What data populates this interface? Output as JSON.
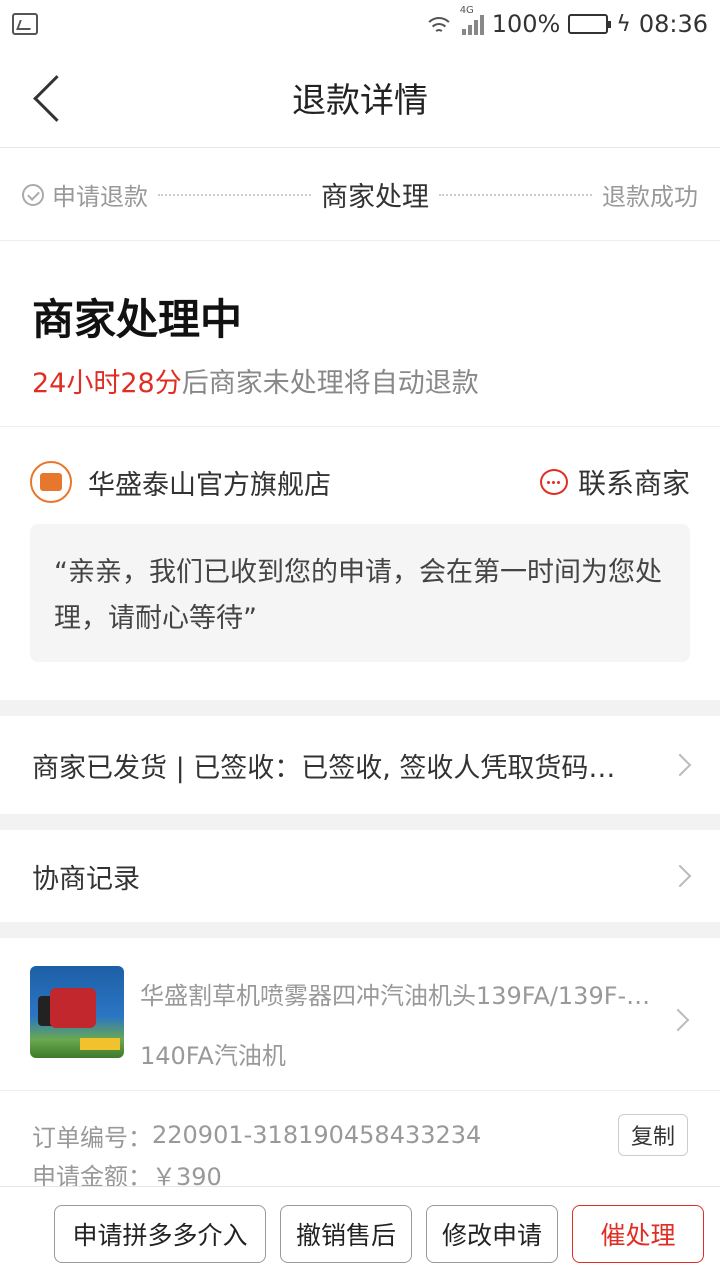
{
  "statusbar": {
    "network": "4G",
    "battery": "100%",
    "battery_level": 1.0,
    "time": "08:36"
  },
  "navbar": {
    "title": "退款详情"
  },
  "steps": {
    "step1": "申请退款",
    "step2": "商家处理",
    "step3": "退款成功"
  },
  "status": {
    "title": "商家处理中",
    "countdown": "24小时28分",
    "countdown_suffix": "后商家未处理将自动退款"
  },
  "store": {
    "name": "华盛泰山官方旗舰店",
    "contact_label": "联系商家",
    "message": "“亲亲，我们已收到您的申请，会在第一时间为您处理，请耐心等待”"
  },
  "logistics": {
    "text": "商家已发货 | 已签收：已签收, 签收人凭取货码…"
  },
  "negotiation": {
    "label": "协商记录"
  },
  "product": {
    "title_line1": "华盛割草机喷雾器四冲汽油机头139FA/139F-…",
    "title_line2": "140FA汽油机"
  },
  "order": {
    "number_label": "订单编号：",
    "number": "220901-318190458433234",
    "copy_label": "复制",
    "amount_label": "申请金额：",
    "amount": "￥390"
  },
  "actions": {
    "intervene": "申请拼多多介入",
    "cancel": "撤销售后",
    "modify": "修改申请",
    "urge": "催处理"
  },
  "colors": {
    "accent_red": "#e02e24"
  }
}
